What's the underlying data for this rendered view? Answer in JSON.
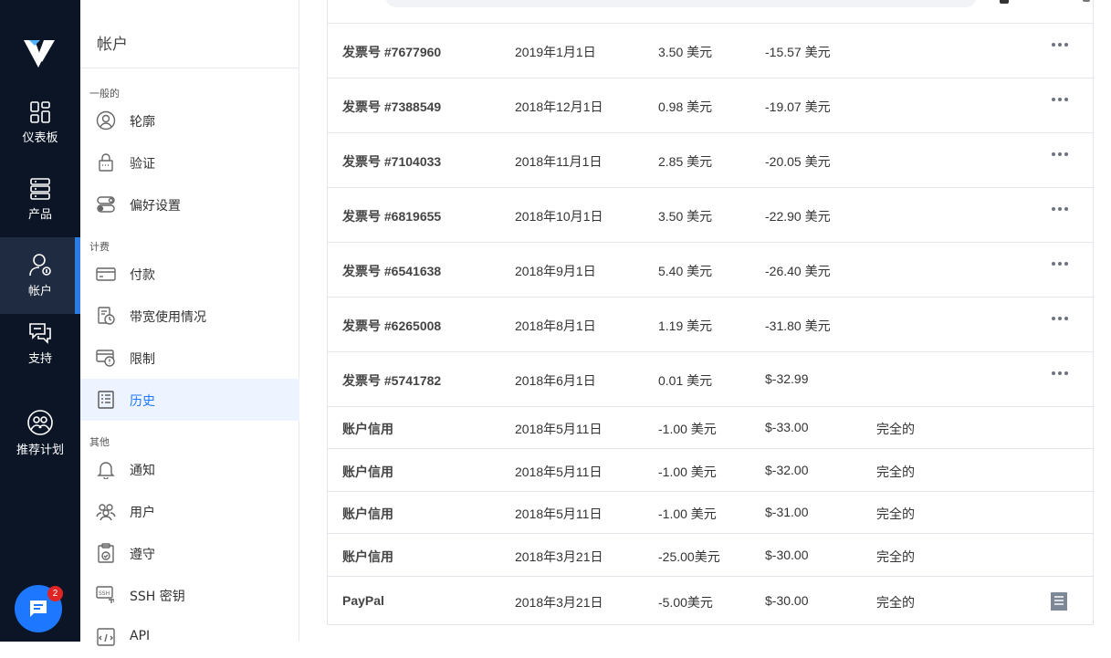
{
  "nav_rail": {
    "logo_icon": "vultr-logo",
    "items": [
      {
        "label": "仪表板",
        "icon": "dashboard-icon"
      },
      {
        "label": "产品",
        "icon": "server-icon"
      },
      {
        "label": "帐户",
        "icon": "account-icon",
        "active": true
      },
      {
        "label": "支持",
        "icon": "support-icon"
      },
      {
        "label": "推荐计划",
        "icon": "referral-icon"
      }
    ],
    "chat_badge": "2"
  },
  "sidebar": {
    "title": "帐户",
    "sections": [
      {
        "label": "一般的",
        "items": [
          {
            "label": "轮廓",
            "icon": "profile-icon"
          },
          {
            "label": "验证",
            "icon": "lock-icon"
          },
          {
            "label": "偏好设置",
            "icon": "toggle-icon"
          }
        ]
      },
      {
        "label": "计费",
        "items": [
          {
            "label": "付款",
            "icon": "card-icon"
          },
          {
            "label": "带宽使用情况",
            "icon": "bandwidth-icon"
          },
          {
            "label": "限制",
            "icon": "limit-icon"
          },
          {
            "label": "历史",
            "icon": "history-icon",
            "active": true
          }
        ]
      },
      {
        "label": "其他",
        "items": [
          {
            "label": "通知",
            "icon": "bell-icon"
          },
          {
            "label": "用户",
            "icon": "users-icon"
          },
          {
            "label": "遵守",
            "icon": "compliance-icon"
          },
          {
            "label": "SSH 密钥",
            "icon": "ssh-icon"
          },
          {
            "label": "API",
            "icon": "api-icon"
          }
        ]
      }
    ]
  },
  "history": {
    "rows": [
      {
        "desc": "发票号 #7677960",
        "date": "2019年1月1日",
        "amount": "3.50 美元",
        "balance": "-15.57 美元",
        "status": "",
        "action": "more"
      },
      {
        "desc": "发票号 #7388549",
        "date": "2018年12月1日",
        "amount": "0.98 美元",
        "balance": "-19.07 美元",
        "status": "",
        "action": "more"
      },
      {
        "desc": "发票号 #7104033",
        "date": "2018年11月1日",
        "amount": "2.85 美元",
        "balance": "-20.05 美元",
        "status": "",
        "action": "more"
      },
      {
        "desc": "发票号 #6819655",
        "date": "2018年10月1日",
        "amount": "3.50 美元",
        "balance": "-22.90 美元",
        "status": "",
        "action": "more"
      },
      {
        "desc": "发票号 #6541638",
        "date": "2018年9月1日",
        "amount": "5.40 美元",
        "balance": "-26.40 美元",
        "status": "",
        "action": "more"
      },
      {
        "desc": "发票号 #6265008",
        "date": "2018年8月1日",
        "amount": "1.19 美元",
        "balance": "-31.80 美元",
        "status": "",
        "action": "more"
      },
      {
        "desc": "发票号 #5741782",
        "date": "2018年6月1日",
        "amount": "0.01 美元",
        "balance": "$-32.99",
        "status": "",
        "action": "more"
      },
      {
        "desc": "账户信用",
        "date": "2018年5月11日",
        "amount": "-1.00 美元",
        "balance": "$-33.00",
        "status": "完全的",
        "action": ""
      },
      {
        "desc": "账户信用",
        "date": "2018年5月11日",
        "amount": "-1.00 美元",
        "balance": "$-32.00",
        "status": "完全的",
        "action": ""
      },
      {
        "desc": "账户信用",
        "date": "2018年5月11日",
        "amount": "-1.00 美元",
        "balance": "$-31.00",
        "status": "完全的",
        "action": ""
      },
      {
        "desc": "账户信用",
        "date": "2018年3月21日",
        "amount": "-25.00美元",
        "balance": "$-30.00",
        "status": "完全的",
        "action": ""
      },
      {
        "desc": "PayPal",
        "date": "2018年3月21日",
        "amount": "-5.00美元",
        "balance": "$-30.00",
        "status": "完全的",
        "action": "receipt"
      }
    ]
  },
  "colors": {
    "rail_bg": "#0b1525",
    "accent": "#1e78ff",
    "active_bg": "#edf4ff"
  }
}
